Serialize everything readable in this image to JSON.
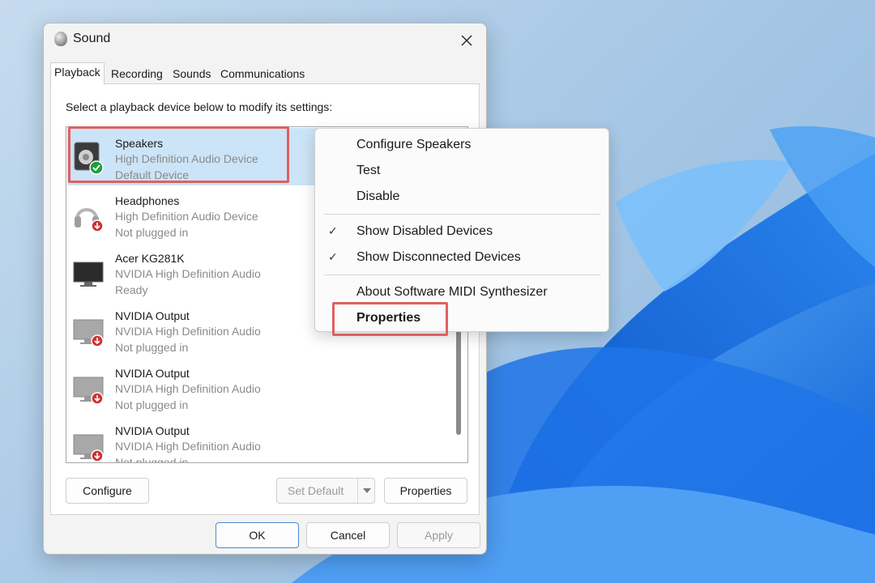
{
  "dialog": {
    "title": "Sound",
    "tabs": [
      "Playback",
      "Recording",
      "Sounds",
      "Communications"
    ],
    "instruction": "Select a playback device below to modify its settings:",
    "devices": [
      {
        "name": "Speakers",
        "description": "High Definition Audio Device",
        "status": "Default Device",
        "icon": "speaker-icon",
        "badge": "default-check",
        "selected": true
      },
      {
        "name": "Headphones",
        "description": "High Definition Audio Device",
        "status": "Not plugged in",
        "icon": "headphones-icon",
        "badge": "unplugged",
        "selected": false
      },
      {
        "name": "Acer KG281K",
        "description": "NVIDIA High Definition Audio",
        "status": "Ready",
        "icon": "monitor-icon",
        "badge": "none",
        "selected": false
      },
      {
        "name": "NVIDIA Output",
        "description": "NVIDIA High Definition Audio",
        "status": "Not plugged in",
        "icon": "monitor-icon",
        "badge": "unplugged",
        "selected": false
      },
      {
        "name": "NVIDIA Output",
        "description": "NVIDIA High Definition Audio",
        "status": "Not plugged in",
        "icon": "monitor-icon",
        "badge": "unplugged",
        "selected": false
      },
      {
        "name": "NVIDIA Output",
        "description": "NVIDIA High Definition Audio",
        "status": "Not plugged in",
        "icon": "monitor-icon",
        "badge": "unplugged",
        "selected": false
      }
    ],
    "buttons": {
      "configure": "Configure",
      "set_default": "Set Default",
      "properties": "Properties",
      "ok": "OK",
      "cancel": "Cancel",
      "apply": "Apply"
    }
  },
  "context_menu": {
    "items": [
      {
        "label": "Configure Speakers",
        "checked": false
      },
      {
        "label": "Test",
        "checked": false
      },
      {
        "label": "Disable",
        "checked": false
      },
      {
        "label": "Show Disabled Devices",
        "checked": true
      },
      {
        "label": "Show Disconnected Devices",
        "checked": true
      },
      {
        "label": "About Software MIDI Synthesizer",
        "checked": false
      },
      {
        "label": "Properties",
        "checked": false,
        "bold": true
      }
    ]
  },
  "colors": {
    "selection": "#cce4f7",
    "highlight": "#e0605f",
    "accent": "#1a73e8"
  }
}
